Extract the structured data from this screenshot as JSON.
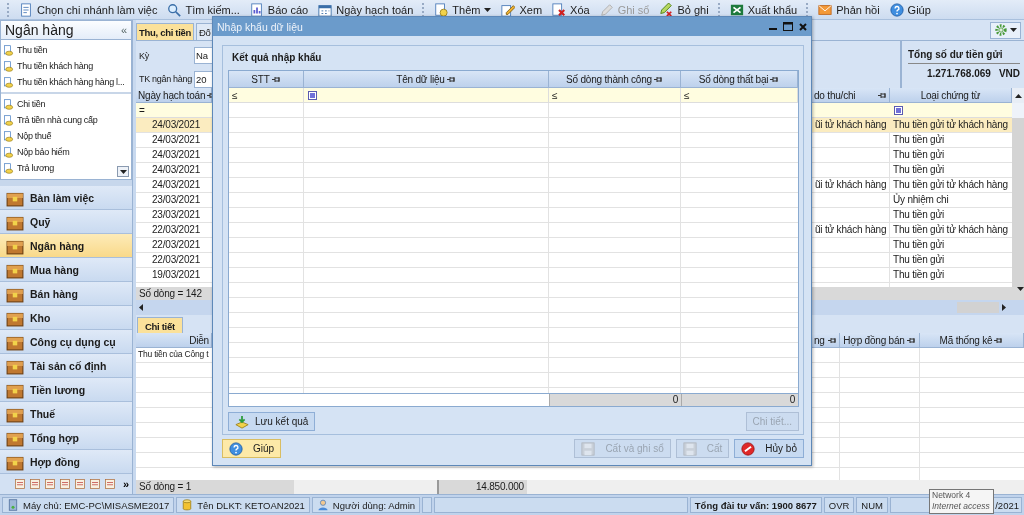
{
  "toolbar": {
    "groups": [
      [
        {
          "label": "Chọn chi nhánh làm việc",
          "disabled": false,
          "dropdown": false
        },
        {
          "label": "Tìm kiếm...",
          "disabled": false,
          "dropdown": false
        },
        {
          "label": "Báo cáo",
          "disabled": false,
          "dropdown": false
        },
        {
          "label": "Ngày hạch toán",
          "disabled": false,
          "dropdown": false
        }
      ],
      [
        {
          "label": "Thêm",
          "disabled": false,
          "dropdown": true
        },
        {
          "label": "Xem",
          "disabled": false,
          "dropdown": false
        },
        {
          "label": "Xóa",
          "disabled": false,
          "dropdown": false
        },
        {
          "label": "Ghi sổ",
          "disabled": true,
          "dropdown": false
        },
        {
          "label": "Bỏ ghi",
          "disabled": false,
          "dropdown": false
        }
      ],
      [
        {
          "label": "Xuất khẩu",
          "disabled": false,
          "dropdown": false
        }
      ],
      [
        {
          "label": "Phản hồi",
          "disabled": false,
          "dropdown": false
        },
        {
          "label": "Giúp",
          "disabled": false,
          "dropdown": false
        }
      ]
    ]
  },
  "sidebar": {
    "title": "Ngân hàng",
    "collapse": "«",
    "task_groups": [
      [
        "Thu tiền",
        "Thu tiền khách hàng",
        "Thu tiền khách hàng hàng l..."
      ],
      [
        "Chi tiền",
        "Trả tiền nhà cung cấp",
        "Nộp thuế",
        "Nộp bảo hiểm",
        "Trả lương"
      ]
    ],
    "modules": [
      {
        "label": "Bàn làm việc",
        "selected": false
      },
      {
        "label": "Quỹ",
        "selected": false
      },
      {
        "label": "Ngân hàng",
        "selected": true
      },
      {
        "label": "Mua hàng",
        "selected": false
      },
      {
        "label": "Bán hàng",
        "selected": false
      },
      {
        "label": "Kho",
        "selected": false
      },
      {
        "label": "Công cụ dụng cụ",
        "selected": false
      },
      {
        "label": "Tài sản cố định",
        "selected": false
      },
      {
        "label": "Tiền lương",
        "selected": false
      },
      {
        "label": "Thuế",
        "selected": false
      },
      {
        "label": "Tổng hợp",
        "selected": false
      },
      {
        "label": "Hợp đồng",
        "selected": false
      }
    ],
    "more": "»"
  },
  "tabs": [
    {
      "label": "Thu, chi tiền",
      "selected": true
    },
    {
      "label": "Đố",
      "selected": false
    }
  ],
  "filters": [
    {
      "label": "Kỳ",
      "value": "Na"
    },
    {
      "label": "TK ngân hàng",
      "value": "20"
    }
  ],
  "balance": {
    "title": "Tổng số dư tiền gửi",
    "amount": "1.271.768.069",
    "currency": "VND"
  },
  "grid": {
    "columns": [
      {
        "title": "Ngày hạch toán",
        "filter": {
          "kind": "operator",
          "text": "="
        }
      },
      {
        "title": "do thu/chi",
        "filter": {
          "kind": "none"
        }
      },
      {
        "title": "Loại chứng từ",
        "filter": {
          "kind": "checkbox",
          "checked": true
        }
      }
    ],
    "rows": [
      {
        "date": "24/03/2021",
        "reason": "ũi tử khách hàng",
        "type": "Thu tiền gửi tử khách hàng",
        "selected": true
      },
      {
        "date": "24/03/2021",
        "type": "Thu tiền gửi",
        "selected": false
      },
      {
        "date": "24/03/2021",
        "type": "Thu tiền gửi",
        "selected": false
      },
      {
        "date": "24/03/2021",
        "type": "Thu tiền gửi",
        "selected": false
      },
      {
        "date": "24/03/2021",
        "reason": "ũi tử khách hàng",
        "type": "Thu tiền gửi tử khách hàng",
        "selected": false
      },
      {
        "date": "23/03/2021",
        "type": "Ủy nhiệm chi",
        "selected": false
      },
      {
        "date": "23/03/2021",
        "type": "Thu tiền gửi",
        "selected": false
      },
      {
        "date": "22/03/2021",
        "reason": "ũi tử khách hàng",
        "type": "Thu tiền gửi tử khách hàng",
        "selected": false
      },
      {
        "date": "22/03/2021",
        "type": "Thu tiền gửi",
        "selected": false
      },
      {
        "date": "22/03/2021",
        "type": "Thu tiền gửi",
        "selected": false
      },
      {
        "date": "19/03/2021",
        "type": "Thu tiền gửi",
        "selected": false
      }
    ],
    "footer": "Số dòng = 142"
  },
  "detail": {
    "tab": {
      "label": "Chi tiết",
      "selected": true
    },
    "columns": [
      "Diễn",
      "ng",
      "Hợp đồng bán",
      "Mã thống kê"
    ],
    "rows": [
      {
        "description": "Thu tiền của Công t"
      }
    ],
    "footer": "Số dòng = 1",
    "total": "14.850.000"
  },
  "dialog": {
    "title": "Nhập khẩu dữ liệu",
    "group_title": "Kết quả nhập khẩu",
    "columns": [
      {
        "title": "STT",
        "filter": {
          "kind": "operator",
          "text": "≤"
        }
      },
      {
        "title": "Tên dữ liệu",
        "filter": {
          "kind": "checkbox",
          "checked": true
        }
      },
      {
        "title": "Số dòng thành công",
        "filter": {
          "kind": "operator",
          "text": "≤"
        }
      },
      {
        "title": "Số dòng thất bại",
        "filter": {
          "kind": "operator",
          "text": "≤"
        }
      }
    ],
    "totals": [
      "0",
      "0"
    ],
    "actions": [
      {
        "label": "Lưu kết quả",
        "kind": "import",
        "disabled": false
      },
      {
        "label": "Chi tiết...",
        "kind": "plain",
        "disabled": true
      }
    ],
    "buttons": [
      {
        "label": "Giúp",
        "kind": "help",
        "disabled": false,
        "focused": true
      },
      {
        "label": "Cất và ghi sổ",
        "kind": "save",
        "disabled": true,
        "focused": false
      },
      {
        "label": "Cất",
        "kind": "save",
        "disabled": true,
        "focused": false
      },
      {
        "label": "Hủy bỏ",
        "kind": "cancel",
        "disabled": false,
        "focused": false
      }
    ]
  },
  "status_bar": {
    "server": "Máy chủ: EMC-PC\\MISASME2017",
    "database": "Tên DLKT: KETOAN2021",
    "user": "Người dùng: Admin",
    "hotline": "Tổng đài tư vấn: 1900 8677",
    "ovr": "OVR",
    "num": "NUM",
    "date": "/2021"
  },
  "tooltip": {
    "title": "Network 4",
    "detail": "Internet access"
  }
}
